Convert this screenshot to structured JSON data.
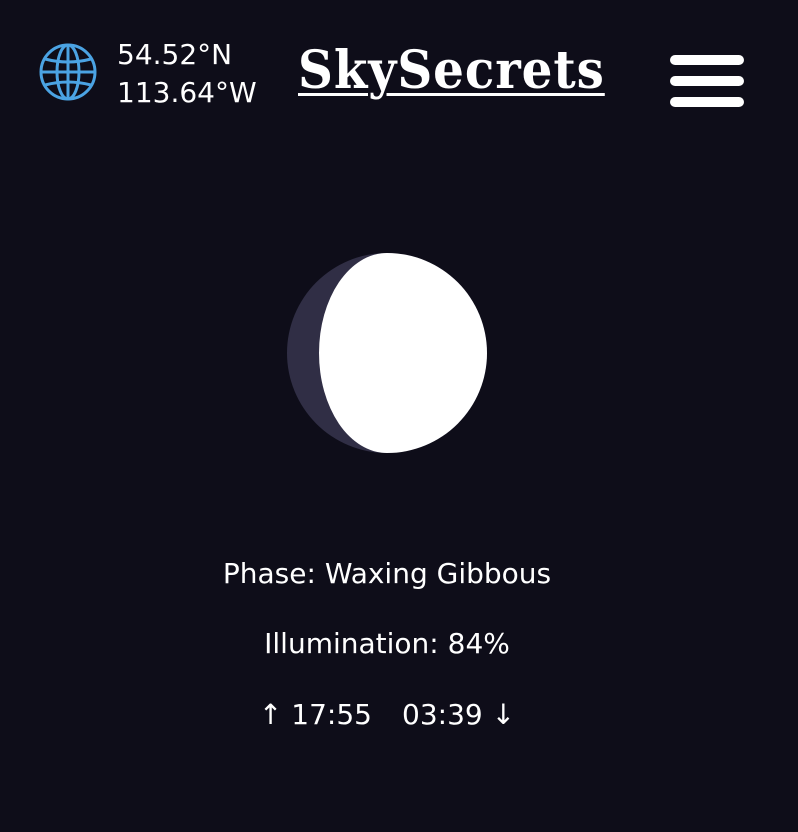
{
  "location": {
    "latitude": "54.52°N",
    "longitude": "113.64°W",
    "icon": "globe-icon",
    "icon_color": "#4ba3e3"
  },
  "header": {
    "brand": "SkySecrets",
    "menu_icon": "hamburger-menu-icon"
  },
  "moon": {
    "phase_label": "Phase:",
    "phase": "Waxing Gibbous",
    "illumination_label": "Illumination:",
    "illumination": "84%",
    "illumination_fraction": 0.84,
    "lit_color": "#ffffff",
    "shadow_color": "#302e45"
  },
  "times": {
    "rise_icon": "↑",
    "moonrise": "17:55",
    "moonset": "03:39",
    "set_icon": "↓"
  },
  "theme": {
    "background": "#0e0d19",
    "text": "#ffffff"
  }
}
